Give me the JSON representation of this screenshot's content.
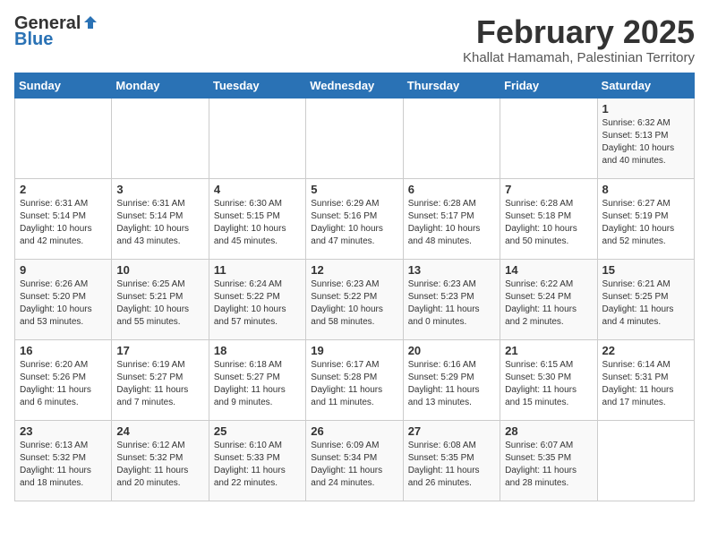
{
  "header": {
    "logo_general": "General",
    "logo_blue": "Blue",
    "month_year": "February 2025",
    "location": "Khallat Hamamah, Palestinian Territory"
  },
  "weekdays": [
    "Sunday",
    "Monday",
    "Tuesday",
    "Wednesday",
    "Thursday",
    "Friday",
    "Saturday"
  ],
  "weeks": [
    [
      {
        "day": "",
        "info": ""
      },
      {
        "day": "",
        "info": ""
      },
      {
        "day": "",
        "info": ""
      },
      {
        "day": "",
        "info": ""
      },
      {
        "day": "",
        "info": ""
      },
      {
        "day": "",
        "info": ""
      },
      {
        "day": "1",
        "info": "Sunrise: 6:32 AM\nSunset: 5:13 PM\nDaylight: 10 hours\nand 40 minutes."
      }
    ],
    [
      {
        "day": "2",
        "info": "Sunrise: 6:31 AM\nSunset: 5:14 PM\nDaylight: 10 hours\nand 42 minutes."
      },
      {
        "day": "3",
        "info": "Sunrise: 6:31 AM\nSunset: 5:14 PM\nDaylight: 10 hours\nand 43 minutes."
      },
      {
        "day": "4",
        "info": "Sunrise: 6:30 AM\nSunset: 5:15 PM\nDaylight: 10 hours\nand 45 minutes."
      },
      {
        "day": "5",
        "info": "Sunrise: 6:29 AM\nSunset: 5:16 PM\nDaylight: 10 hours\nand 47 minutes."
      },
      {
        "day": "6",
        "info": "Sunrise: 6:28 AM\nSunset: 5:17 PM\nDaylight: 10 hours\nand 48 minutes."
      },
      {
        "day": "7",
        "info": "Sunrise: 6:28 AM\nSunset: 5:18 PM\nDaylight: 10 hours\nand 50 minutes."
      },
      {
        "day": "8",
        "info": "Sunrise: 6:27 AM\nSunset: 5:19 PM\nDaylight: 10 hours\nand 52 minutes."
      }
    ],
    [
      {
        "day": "9",
        "info": "Sunrise: 6:26 AM\nSunset: 5:20 PM\nDaylight: 10 hours\nand 53 minutes."
      },
      {
        "day": "10",
        "info": "Sunrise: 6:25 AM\nSunset: 5:21 PM\nDaylight: 10 hours\nand 55 minutes."
      },
      {
        "day": "11",
        "info": "Sunrise: 6:24 AM\nSunset: 5:22 PM\nDaylight: 10 hours\nand 57 minutes."
      },
      {
        "day": "12",
        "info": "Sunrise: 6:23 AM\nSunset: 5:22 PM\nDaylight: 10 hours\nand 58 minutes."
      },
      {
        "day": "13",
        "info": "Sunrise: 6:23 AM\nSunset: 5:23 PM\nDaylight: 11 hours\nand 0 minutes."
      },
      {
        "day": "14",
        "info": "Sunrise: 6:22 AM\nSunset: 5:24 PM\nDaylight: 11 hours\nand 2 minutes."
      },
      {
        "day": "15",
        "info": "Sunrise: 6:21 AM\nSunset: 5:25 PM\nDaylight: 11 hours\nand 4 minutes."
      }
    ],
    [
      {
        "day": "16",
        "info": "Sunrise: 6:20 AM\nSunset: 5:26 PM\nDaylight: 11 hours\nand 6 minutes."
      },
      {
        "day": "17",
        "info": "Sunrise: 6:19 AM\nSunset: 5:27 PM\nDaylight: 11 hours\nand 7 minutes."
      },
      {
        "day": "18",
        "info": "Sunrise: 6:18 AM\nSunset: 5:27 PM\nDaylight: 11 hours\nand 9 minutes."
      },
      {
        "day": "19",
        "info": "Sunrise: 6:17 AM\nSunset: 5:28 PM\nDaylight: 11 hours\nand 11 minutes."
      },
      {
        "day": "20",
        "info": "Sunrise: 6:16 AM\nSunset: 5:29 PM\nDaylight: 11 hours\nand 13 minutes."
      },
      {
        "day": "21",
        "info": "Sunrise: 6:15 AM\nSunset: 5:30 PM\nDaylight: 11 hours\nand 15 minutes."
      },
      {
        "day": "22",
        "info": "Sunrise: 6:14 AM\nSunset: 5:31 PM\nDaylight: 11 hours\nand 17 minutes."
      }
    ],
    [
      {
        "day": "23",
        "info": "Sunrise: 6:13 AM\nSunset: 5:32 PM\nDaylight: 11 hours\nand 18 minutes."
      },
      {
        "day": "24",
        "info": "Sunrise: 6:12 AM\nSunset: 5:32 PM\nDaylight: 11 hours\nand 20 minutes."
      },
      {
        "day": "25",
        "info": "Sunrise: 6:10 AM\nSunset: 5:33 PM\nDaylight: 11 hours\nand 22 minutes."
      },
      {
        "day": "26",
        "info": "Sunrise: 6:09 AM\nSunset: 5:34 PM\nDaylight: 11 hours\nand 24 minutes."
      },
      {
        "day": "27",
        "info": "Sunrise: 6:08 AM\nSunset: 5:35 PM\nDaylight: 11 hours\nand 26 minutes."
      },
      {
        "day": "28",
        "info": "Sunrise: 6:07 AM\nSunset: 5:35 PM\nDaylight: 11 hours\nand 28 minutes."
      },
      {
        "day": "",
        "info": ""
      }
    ]
  ]
}
